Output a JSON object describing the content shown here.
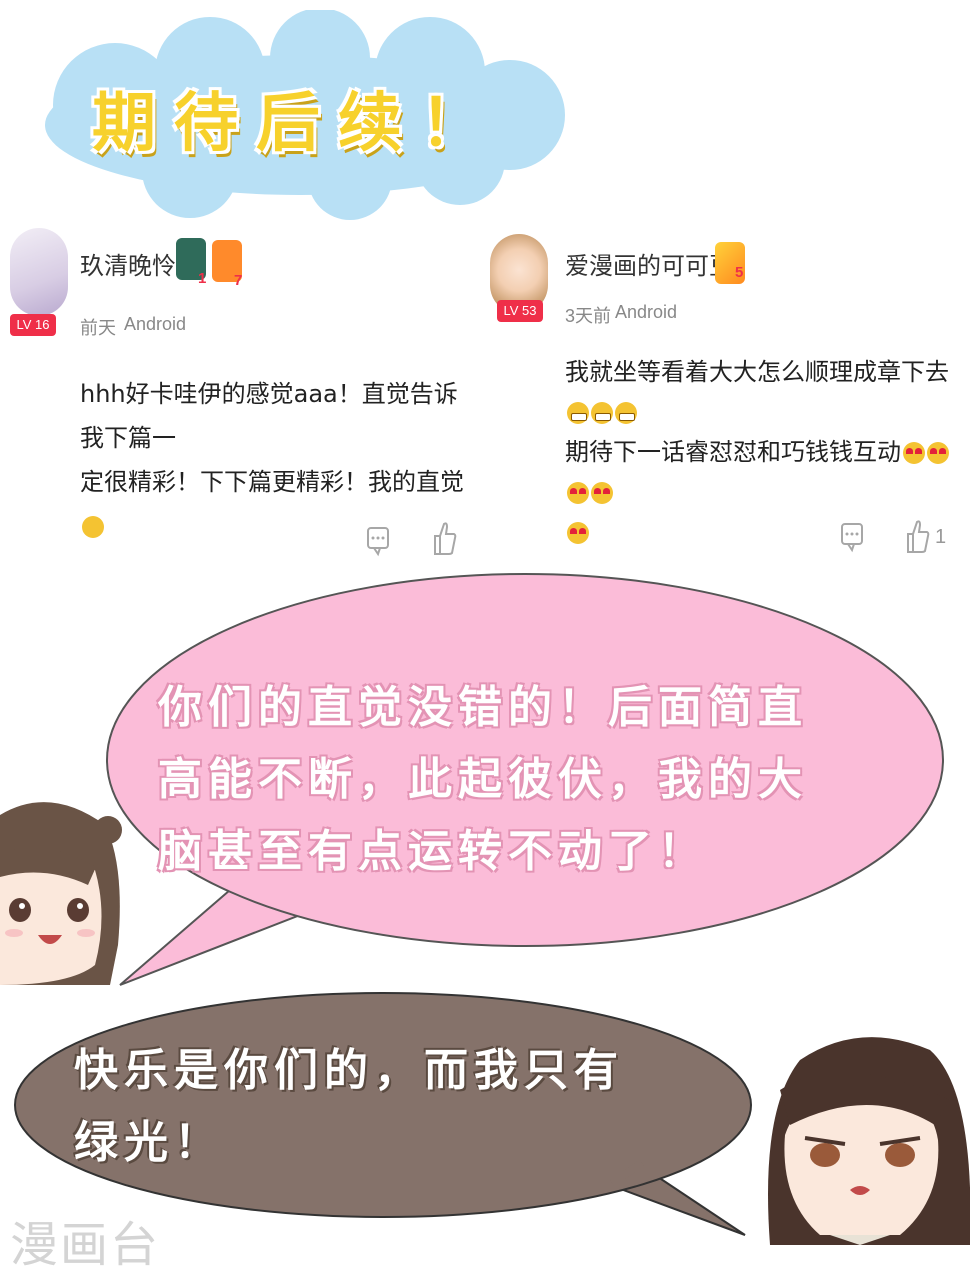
{
  "title_cloud": {
    "text": "期待后续！"
  },
  "comments": [
    {
      "username": "玖清晚怜",
      "level": "LV 16",
      "badges": [
        {
          "icon": "trophy-icon",
          "count": "1"
        },
        {
          "icon": "gamepad-icon",
          "count": "7"
        }
      ],
      "time": "前天",
      "device": "Android",
      "lines": [
        "hhh好卡哇伊的感觉aaa！直觉告诉我下篇一",
        "定很精彩！下下篇更精彩！我的直觉"
      ],
      "like_count": ""
    },
    {
      "username": "爱漫画的可可豆",
      "level": "LV 53",
      "badges": [
        {
          "icon": "fan-badge-icon",
          "count": "5"
        }
      ],
      "time": "3天前",
      "device": "Android",
      "lines": [
        "我就坐等看着大大怎么顺理成章下去",
        "期待下一话睿怼怼和巧钱钱互动"
      ],
      "like_count": "1"
    }
  ],
  "pink_bubble": {
    "lines": [
      "你们的直觉没错的！后面简直",
      "高能不断，此起彼伏，我的大",
      "脑甚至有点运转不动了！"
    ]
  },
  "brown_bubble": {
    "lines": [
      "快乐是你们的，而我只有",
      "绿光！"
    ]
  },
  "watermark": "漫画台",
  "colors": {
    "cloud": "#b8e0f5",
    "title": "#f7d12c",
    "pink_bubble": "#fbbcd8",
    "brown_bubble": "#85726a",
    "level_badge": "#ef2f49"
  }
}
